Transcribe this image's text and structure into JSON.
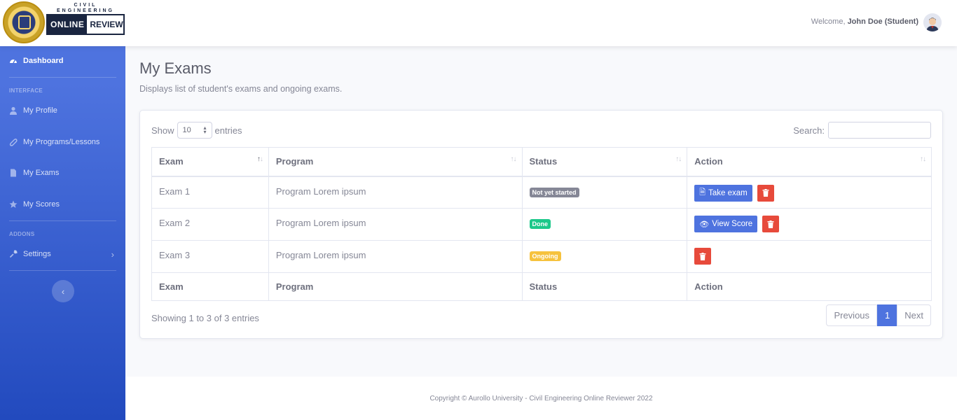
{
  "header": {
    "logo_top1": "CIVIL",
    "logo_top2": "ENGINEERING",
    "logo_online": "ONLINE",
    "logo_review": "REVIEW",
    "welcome_prefix": "Welcome,",
    "user_name": "John Doe (Student)"
  },
  "sidebar": {
    "dashboard": "Dashboard",
    "heading_interface": "INTERFACE",
    "my_profile": "My Profile",
    "my_programs": "My Programs/Lessons",
    "my_exams": "My Exams",
    "my_scores": "My Scores",
    "heading_addons": "ADDONS",
    "settings": "Settings"
  },
  "page": {
    "title": "My Exams",
    "subtitle": "Displays list of student's exams and ongoing exams."
  },
  "table_controls": {
    "show_label": "Show",
    "entries_value": "10",
    "entries_label": "entries",
    "search_label": "Search:",
    "search_value": ""
  },
  "table": {
    "columns": [
      "Exam",
      "Program",
      "Status",
      "Action"
    ],
    "rows": [
      {
        "exam": "Exam 1",
        "program": "Program Lorem ipsum",
        "status": "Not yet started",
        "action": "Take exam"
      },
      {
        "exam": "Exam 2",
        "program": "Program Lorem ipsum",
        "status": "Done",
        "action": "View Score"
      },
      {
        "exam": "Exam 3",
        "program": "Program Lorem ipsum",
        "status": "Ongoing",
        "action": ""
      }
    ]
  },
  "pagination": {
    "info": "Showing 1 to 3 of 3 entries",
    "previous": "Previous",
    "current": "1",
    "next": "Next"
  },
  "footer": {
    "copyright": "Copyright © Aurollo University - Civil Engineering Online Reviewer 2022"
  },
  "colors": {
    "primary": "#4e73df",
    "danger": "#e74a3b",
    "success": "#1cc88a",
    "warning": "#f6c23e",
    "secondary": "#858796"
  }
}
